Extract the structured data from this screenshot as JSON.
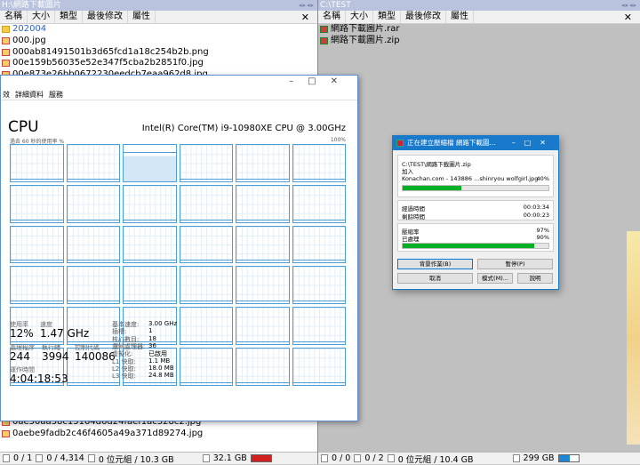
{
  "left_pane": {
    "path": "H:\\網路下載圖片",
    "columns": [
      "名稱",
      "大小",
      "類型",
      "最後修改",
      "屬性"
    ],
    "files_top": [
      {
        "name": "202004",
        "type": "folder"
      },
      {
        "name": "000.jpg",
        "type": "file"
      },
      {
        "name": "000ab81491501b3d65fcd1a18c254b2b.png",
        "type": "file"
      },
      {
        "name": "00e159b56035e52e347f5cba2b2851f0.jpg",
        "type": "file"
      },
      {
        "name": "00e873e26bb0672230eedcb7eaa962d8.jpg",
        "type": "file"
      }
    ],
    "files_bottom": [
      {
        "name": "0ae50aa38c15164d6d24faef1ac328c2.jpg",
        "type": "file"
      },
      {
        "name": "0aebe9fadb2c46f4605a49a371d89274.jpg",
        "type": "file"
      }
    ],
    "status": {
      "selected": "0 / 1",
      "files": "0 / 4,314",
      "size": "0 位元組 / 10.3 GB",
      "free": "32.1 GB"
    }
  },
  "right_pane": {
    "path": "C:\\TEST",
    "columns": [
      "名稱",
      "大小",
      "類型",
      "最後修改",
      "屬性"
    ],
    "files": [
      {
        "name": "網路下載圖片.rar"
      },
      {
        "name": "網路下載圖片.zip"
      }
    ],
    "status": {
      "selected": "0 / 0",
      "files": "0 / 2",
      "size": "0 位元組 / 10.4 GB",
      "free": "299 GB"
    }
  },
  "task_manager": {
    "tabs": [
      "效",
      "詳細資料",
      "服務"
    ],
    "title": "CPU",
    "model": "Intel(R) Core(TM) i9-10980XE CPU @ 3.00GHz",
    "graph_caption": "過去 60 秒的使用率 %",
    "graph_max": "100%",
    "stats": {
      "util_label": "使用率",
      "util": "12%",
      "speed_label": "速度",
      "speed": "1.47 GHz",
      "proc_label": "處理程序",
      "proc": "244",
      "threads_label": "執行緒",
      "threads": "3994",
      "handles_label": "控制代碼",
      "handles": "140086",
      "uptime_label": "運作時間",
      "uptime": "4:04:18:53"
    },
    "specs": [
      {
        "label": "基本速度:",
        "value": "3.00 GHz"
      },
      {
        "label": "插槽:",
        "value": "1"
      },
      {
        "label": "核心數目:",
        "value": "18"
      },
      {
        "label": "邏輯處理器:",
        "value": "36"
      },
      {
        "label": "虛擬化:",
        "value": "已啟用"
      },
      {
        "label": "L1 快取:",
        "value": "1.1 MB"
      },
      {
        "label": "L2 快取:",
        "value": "18.0 MB"
      },
      {
        "label": "L3 快取:",
        "value": "24.8 MB"
      }
    ]
  },
  "rar_dialog": {
    "title": "正在建立壓縮檔 網路下載圖...",
    "archive_path": "C:\\TEST\\網路下載圖片.zip",
    "action": "加入",
    "current_file": "Konachan.com - 143886 ...shinryou wolfgirl.jpg",
    "current_pct": "40%",
    "current_progress": 0.4,
    "elapsed_label": "經過時間",
    "elapsed": "00:03:34",
    "remaining_label": "剩餘時間",
    "remaining": "00:00:23",
    "ratio_label": "壓縮率",
    "ratio": "97%",
    "processed_label": "已處理",
    "processed": "90%",
    "total_progress": 0.9,
    "buttons": {
      "background": "背景作業(B)",
      "pause": "暫停(P)",
      "cancel": "取消",
      "mode": "模式(M)...",
      "help": "說明"
    }
  },
  "colors": {
    "path_bar": "#b9c3dd",
    "progress": "#06b025",
    "rar_title": "#1979ca",
    "graph_line": "#4a9fd8",
    "low_disk": "#d21f1f"
  }
}
